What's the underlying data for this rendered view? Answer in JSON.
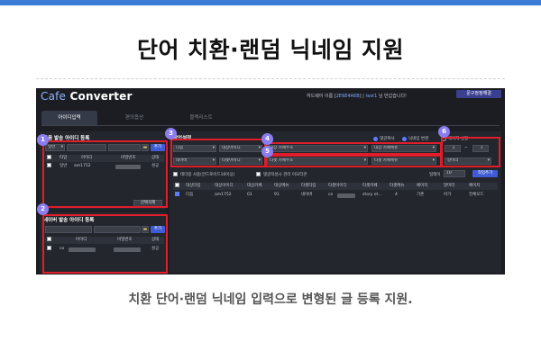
{
  "headline": "단어 치환·랜덤 닉네임 지원",
  "caption": "치환 단어·랜덤 닉네임 입력으로 변형된 글 등록 지원.",
  "app": {
    "logo_prefix": "Cafe",
    "logo_suffix": " Converter",
    "welcome_prefix": "하드웨어 이름 [",
    "welcome_code": "2E6E4A6B",
    "welcome_mid": "] | ",
    "welcome_user": "test1",
    "welcome_suffix": " 님 반갑습니다!",
    "inquiry_button": "문구정정해결",
    "tabs": [
      {
        "label": "아이디입력",
        "active": true
      },
      {
        "label": "편의옵션",
        "active": false
      },
      {
        "label": "블랙리스트",
        "active": false
      }
    ]
  },
  "daum_panel": {
    "title": "다음 발송 아이디 등록",
    "type_select": "일반",
    "add_button": "추가",
    "columns": [
      "타입",
      "아이디",
      "비밀번호",
      "상태"
    ],
    "rows": [
      {
        "type": "일반",
        "id": "am1752",
        "status": "성공"
      }
    ],
    "delete_button": "선택삭제"
  },
  "naver_panel": {
    "title": "네이버 발송 아이디 등록",
    "add_button": "추가",
    "columns": [
      "아이디",
      "비밀번호",
      "상태"
    ],
    "rows": [
      {
        "id": "co",
        "status": "성공"
      }
    ]
  },
  "task_panel": {
    "title": "작업설정",
    "row1": [
      "다음",
      "대상아이디",
      "대상 카페주소",
      "대상 카페메뉴"
    ],
    "row2": [
      "네이버",
      "타겟아이디",
      "타겟 카페주소",
      "타겟 카페메뉴"
    ],
    "opt_copy": "댓글복사",
    "opt_nickname": "닉네임 변경",
    "page_setting": "페이지 설정",
    "page_from": "1",
    "page_tilde": "~",
    "page_to": "1",
    "keyword_select": "말머리",
    "add_task_button": "작업추가",
    "chk_tethering": "테더링 사용(안드로이드10이상)",
    "chk_comment": "댓글작성시 관리 이모티콘",
    "delay_label": "딜레이",
    "delay_value": "10",
    "columns": [
      "대상타입",
      "대상아이디",
      "대상카페",
      "대상메뉴",
      "타겟타입",
      "타겟아이디",
      "타겟카페",
      "타겟메뉴",
      "페이지",
      "말머리",
      "페이지"
    ],
    "rows": [
      {
        "c1": "다음",
        "c2": "am1752",
        "c3": "01",
        "c4": "91",
        "c5": "네이버",
        "c6": "co",
        "c7": "",
        "c8": "story ot...",
        "c9": "4",
        "c10": "기존",
        "c11": "아가",
        "c12": "전체모드"
      }
    ]
  },
  "badges": [
    "1",
    "2",
    "3",
    "4",
    "5",
    "6"
  ],
  "colors": {
    "highlight_box": "#e01e2b",
    "badge": "#8b7dee",
    "primary_button": "#3f5bd6",
    "app_background": "#1b1d22"
  }
}
